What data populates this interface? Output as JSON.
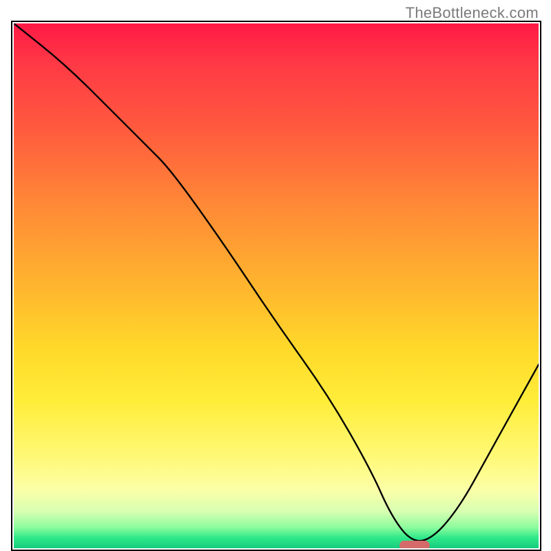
{
  "watermark": "TheBottleneck.com",
  "chart_data": {
    "type": "line",
    "title": "",
    "xlabel": "",
    "ylabel": "",
    "xlim": [
      0,
      100
    ],
    "ylim": [
      0,
      100
    ],
    "grid": false,
    "legend": false,
    "series": [
      {
        "name": "bottleneck-curve",
        "x": [
          0,
          10,
          20,
          25,
          30,
          40,
          50,
          60,
          68,
          72,
          76,
          80,
          85,
          90,
          95,
          100
        ],
        "values": [
          100,
          92,
          82,
          77,
          72,
          58,
          43,
          29,
          15,
          6,
          1,
          2,
          8,
          17,
          26,
          35
        ]
      }
    ],
    "annotations": [
      {
        "name": "optimum-marker",
        "x": 76,
        "y": 1,
        "color": "#d46a6a"
      }
    ],
    "background_gradient": {
      "direction": "vertical",
      "stops": [
        {
          "pos": 0.0,
          "color": "#ff1a45"
        },
        {
          "pos": 0.5,
          "color": "#ffb52e"
        },
        {
          "pos": 0.82,
          "color": "#fff873"
        },
        {
          "pos": 0.96,
          "color": "#8dfc9d"
        },
        {
          "pos": 1.0,
          "color": "#16cc7e"
        }
      ]
    }
  }
}
